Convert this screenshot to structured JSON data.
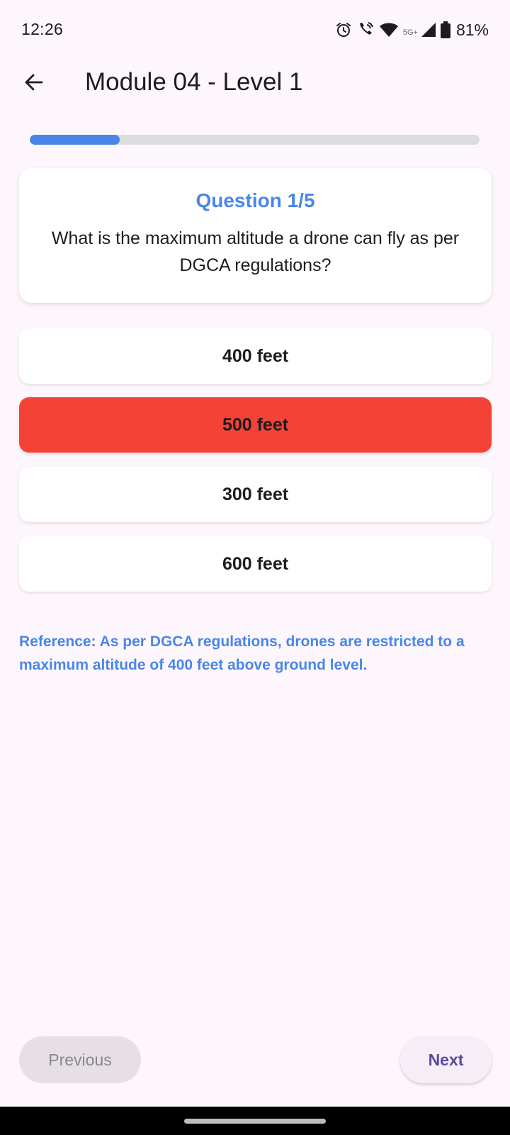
{
  "status_bar": {
    "time": "12:26",
    "network_label": "5G+",
    "battery": "81%",
    "icons": [
      "alarm-icon",
      "wifi-call-icon",
      "wifi-icon",
      "signal-icon",
      "battery-icon"
    ]
  },
  "app_bar": {
    "title": "Module 04 - Level 1",
    "back_icon": "arrow-left-icon"
  },
  "progress": {
    "current": 1,
    "total": 5,
    "fraction": 0.2,
    "color": "#4a86e8"
  },
  "question": {
    "number_label": "Question 1/5",
    "text": "What is the maximum altitude a drone can fly as per DGCA regulations?"
  },
  "options": [
    {
      "label": "400 feet",
      "state": "default"
    },
    {
      "label": "500 feet",
      "state": "selected-wrong"
    },
    {
      "label": "300 feet",
      "state": "default"
    },
    {
      "label": "600 feet",
      "state": "default"
    }
  ],
  "reference": {
    "text": "Reference: As per DGCA regulations, drones are restricted to a maximum altitude of 400 feet above ground level."
  },
  "footer": {
    "previous_label": "Previous",
    "next_label": "Next"
  },
  "colors": {
    "accent": "#4a86e8",
    "wrong": "#f44336",
    "background": "#fdf7fd"
  }
}
